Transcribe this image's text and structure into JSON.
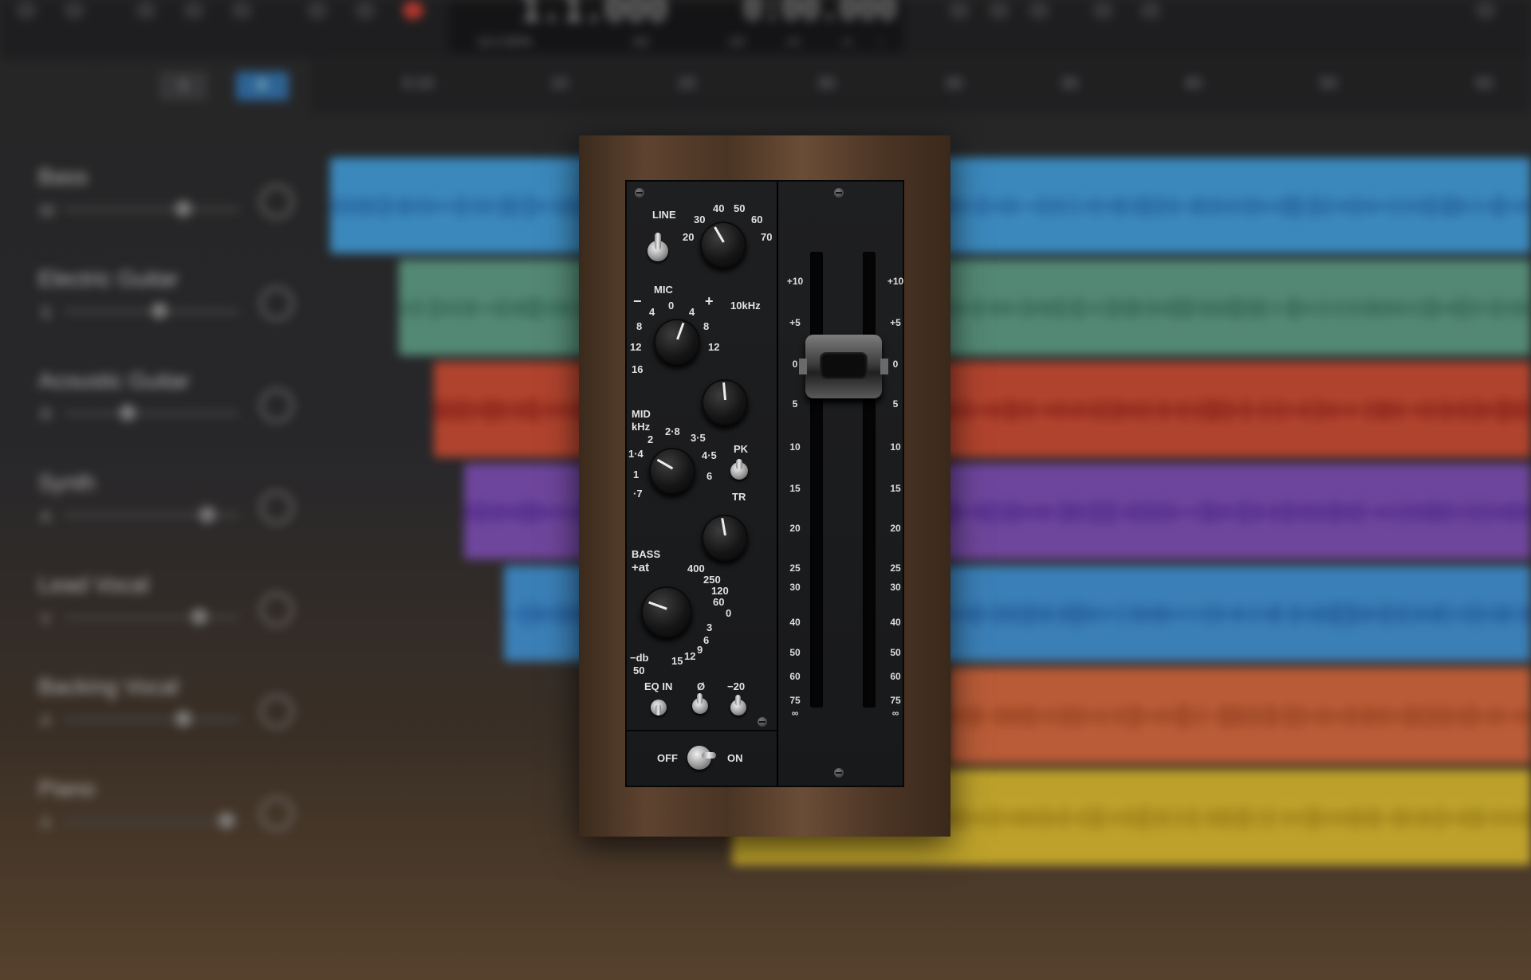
{
  "transport": {
    "position": "1.1.000",
    "time": "0:00.000",
    "tempo": "112.0 BPM",
    "signature": "4/4",
    "key_or_sub": "1/4",
    "extra1": "▪▪▪",
    "extra2": "▪▪",
    "extra3": "▫"
  },
  "header_buttons": {
    "s_label": "S",
    "r_label": "R"
  },
  "ruler_marks": [
    "0:10",
    "10",
    "20",
    "30",
    "30",
    "30",
    "40",
    "50",
    "50"
  ],
  "tracks": [
    {
      "name": "Bass",
      "letter": "M",
      "clip_color": "#3f9ad6",
      "wave_color": "#2a74b8"
    },
    {
      "name": "Electric Guitar",
      "letter": "S",
      "clip_color": "#5b9a82",
      "wave_color": "#3f7a63"
    },
    {
      "name": "Acoustic Guitar",
      "letter": "R",
      "clip_color": "#c8492f",
      "wave_color": "#a0261a"
    },
    {
      "name": "Synth",
      "letter": "A",
      "clip_color": "#7a4bb0",
      "wave_color": "#5b2ea0"
    },
    {
      "name": "Lead Vocal",
      "letter": "V",
      "clip_color": "#3c8ed0",
      "wave_color": "#2468b4"
    },
    {
      "name": "Backing Vocal",
      "letter": "A",
      "clip_color": "#d0643a",
      "wave_color": "#ae4a24"
    },
    {
      "name": "Piano",
      "letter": "A",
      "clip_color": "#d2b42c",
      "wave_color": "#b09018"
    }
  ],
  "plugin": {
    "labels": {
      "line": "LINE",
      "mic": "MIC",
      "minus": "−",
      "plus": "+",
      "tenk": "10kHz",
      "mid": "MID",
      "khz": "kHz",
      "pk": "PK",
      "tr": "TR",
      "bass": "BASS",
      "att": "+at",
      "db": "−db",
      "fifty": "50",
      "eqin": "EQ IN",
      "phase": "Ø",
      "minus20": "−20",
      "off": "OFF",
      "on": "ON"
    },
    "gain_scale": [
      "20",
      "30",
      "40",
      "50",
      "60",
      "70"
    ],
    "hf_scale": [
      "16",
      "12",
      "8",
      "4",
      "0",
      "4",
      "8",
      "12"
    ],
    "mid_scale": [
      "·7",
      "1",
      "1·4",
      "2",
      "2·8",
      "3·5",
      "4·5",
      "6"
    ],
    "bass_scale": [
      "400",
      "250",
      "120",
      "60",
      "0",
      "3",
      "6",
      "9",
      "12",
      "15"
    ],
    "fader_scale": [
      "+10",
      "+5",
      "0",
      "5",
      "10",
      "15",
      "20",
      "25",
      "30",
      "40",
      "50",
      "60",
      "75",
      "∞"
    ]
  }
}
